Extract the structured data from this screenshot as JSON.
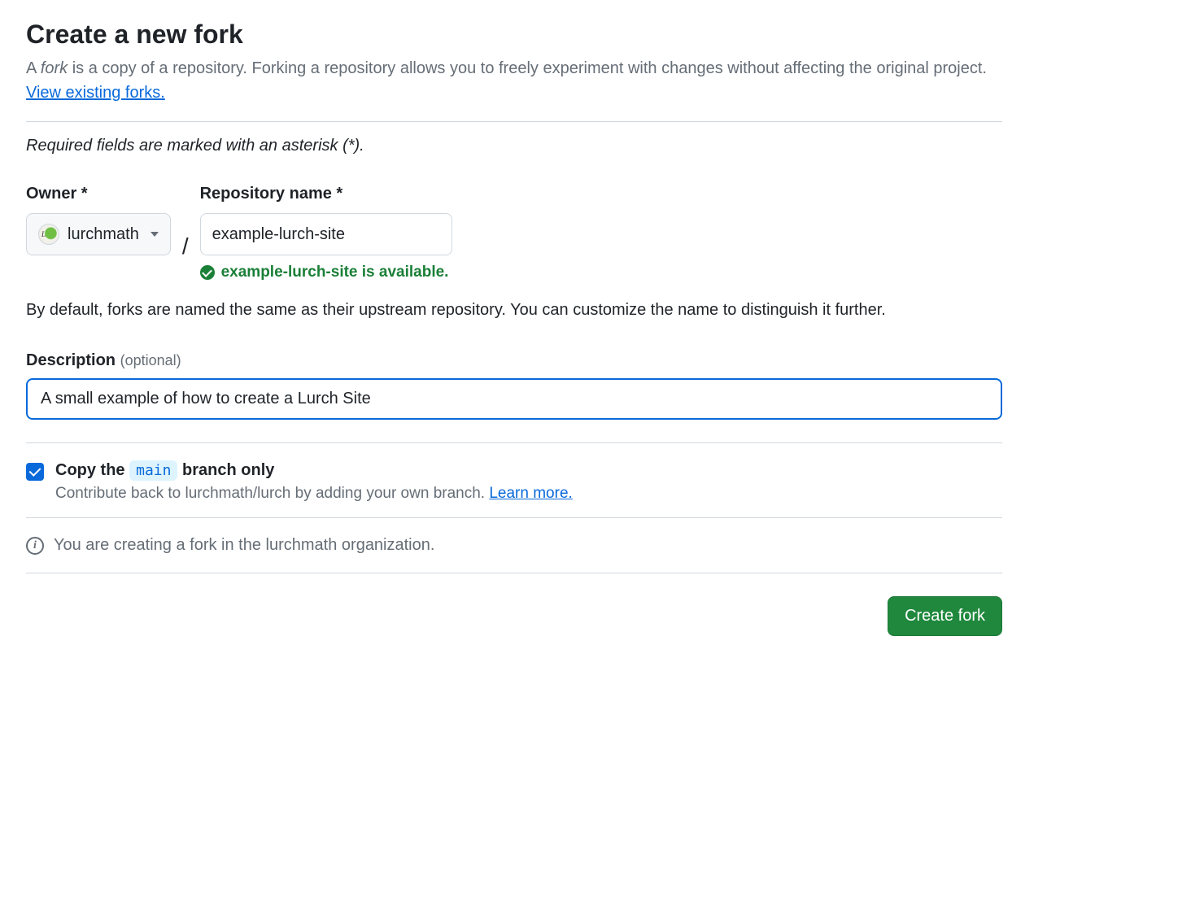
{
  "header": {
    "title": "Create a new fork",
    "subtitle_prefix": "A ",
    "subtitle_em": "fork",
    "subtitle_mid": " is a copy of a repository. Forking a repository allows you to freely experiment with changes without affecting the original project. ",
    "view_existing_link": "View existing forks."
  },
  "required_note": "Required fields are marked with an asterisk (*).",
  "owner": {
    "label": "Owner *",
    "selected": "lurchmath",
    "avatar_letter": "L"
  },
  "repo": {
    "label": "Repository name *",
    "value": "example-lurch-site",
    "availability_text": "example-lurch-site is available."
  },
  "help_text": "By default, forks are named the same as their upstream repository. You can customize the name to distinguish it further.",
  "description": {
    "label": "Description",
    "optional": "(optional)",
    "value": "A small example of how to create a Lurch Site"
  },
  "copy_branch": {
    "checked": true,
    "title_prefix": "Copy the ",
    "branch": "main",
    "title_suffix": " branch only",
    "subtext_prefix": "Contribute back to lurchmath/lurch by adding your own branch. ",
    "learn_more": "Learn more."
  },
  "info_text": "You are creating a fork in the lurchmath organization.",
  "actions": {
    "create": "Create fork"
  }
}
